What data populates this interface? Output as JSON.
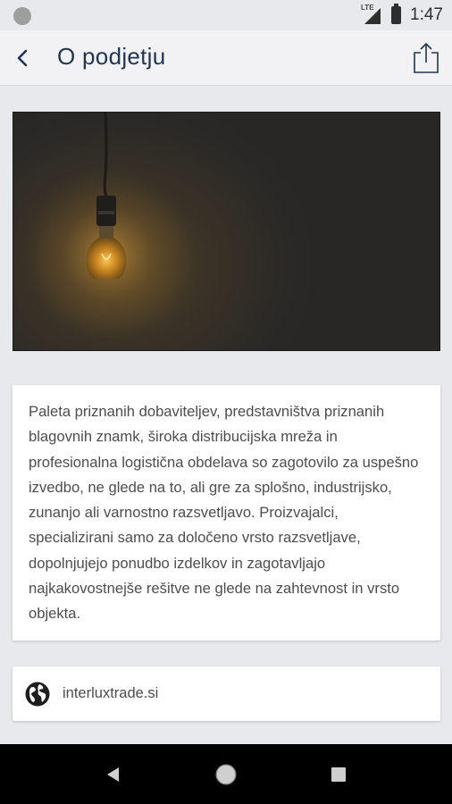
{
  "status_bar": {
    "network_label": "LTE",
    "time": "1:47"
  },
  "app_bar": {
    "title": "O podjetju",
    "back_icon": "chevron-left-icon",
    "share_icon": "share-icon"
  },
  "content": {
    "hero_image": "light-bulb-photo",
    "description": "Paleta priznanih dobaviteljev, predstavništva priznanih blagovnih znamk, široka distribucijska mreža in profesionalna logistična obdelava so zagotovilo za uspešno izvedbo, ne glede na to, ali gre za splošno, industrijsko, zunanjo ali varnostno razsvetljavo. Proizvajalci, specializirani samo za določeno vrsto razsvetljave, dopolnjujejo ponudbo izdelkov in zagotavljajo najkakovostnejše rešitve ne glede na zahtevnost in vrsto objekta.",
    "website": {
      "icon": "globe-icon",
      "label": "interluxtrade.si"
    }
  },
  "nav_bar": {
    "back": "triangle-back-icon",
    "home": "circle-home-icon",
    "recents": "square-recents-icon"
  }
}
